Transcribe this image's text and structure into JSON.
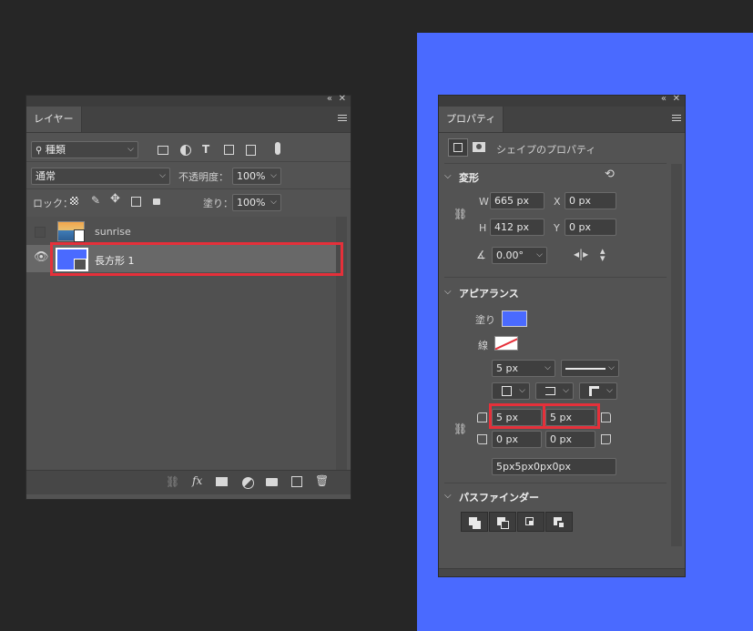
{
  "layers_panel": {
    "tab": "レイヤー",
    "filter_kind": "種類",
    "blend_mode": "通常",
    "opacity_label": "不透明度：",
    "opacity_value": "100%",
    "lock_label": "ロック：",
    "fill_label": "塗り：",
    "fill_value": "100%",
    "layers": [
      {
        "name": "sunrise",
        "visible": false
      },
      {
        "name": "長方形 1",
        "visible": true,
        "selected": true
      }
    ]
  },
  "properties_panel": {
    "tab": "プロパティ",
    "subtitle": "シェイプのプロパティ",
    "transform": {
      "title": "変形",
      "w_label": "W",
      "w_value": "665 px",
      "x_label": "X",
      "x_value": "0 px",
      "h_label": "H",
      "h_value": "412 px",
      "y_label": "Y",
      "y_value": "0 px",
      "angle_value": "0.00°"
    },
    "appearance": {
      "title": "アピアランス",
      "fill_label": "塗り",
      "fill_color": "#4a6aff",
      "stroke_label": "線",
      "stroke_width": "5 px",
      "corner_tl": "5 px",
      "corner_tr": "5 px",
      "corner_bl": "0 px",
      "corner_br": "0 px",
      "corner_summary": "5px5px0px0px"
    },
    "pathfinder": {
      "title": "パスファインダー"
    }
  },
  "colors": {
    "canvas": "#4a6aff",
    "highlight": "#e5303a",
    "panel_bg": "#535353",
    "app_bg": "#262626"
  }
}
